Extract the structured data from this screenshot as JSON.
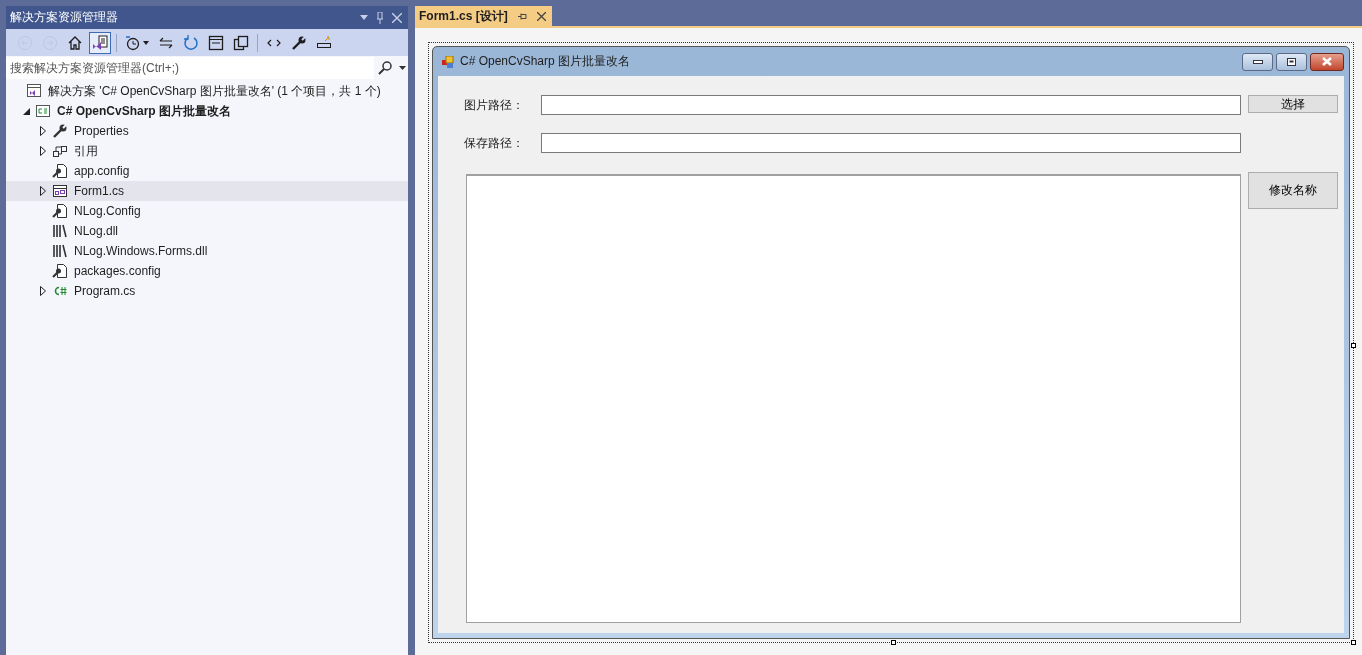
{
  "solution_explorer": {
    "title": "解决方案资源管理器",
    "toolbar": [
      {
        "kind": "back",
        "disabled": true,
        "pressed": false
      },
      {
        "kind": "forward",
        "disabled": true,
        "pressed": false
      },
      {
        "kind": "home",
        "disabled": false,
        "pressed": false
      },
      {
        "kind": "switch-views",
        "disabled": false,
        "pressed": true
      },
      {
        "kind": "pending-changes",
        "disabled": false,
        "pressed": false
      },
      {
        "kind": "sync",
        "disabled": false,
        "pressed": false
      },
      {
        "kind": "refresh",
        "disabled": false,
        "pressed": false
      },
      {
        "kind": "collapse",
        "disabled": false,
        "pressed": false
      },
      {
        "kind": "show-all",
        "disabled": false,
        "pressed": false
      },
      {
        "kind": "code",
        "disabled": false,
        "pressed": false
      },
      {
        "kind": "properties",
        "disabled": false,
        "pressed": false
      },
      {
        "kind": "preview",
        "disabled": false,
        "pressed": false
      }
    ],
    "search": {
      "placeholder": "搜索解决方案资源管理器(Ctrl+;)"
    },
    "tree": [
      {
        "kind": "solution",
        "label": "解决方案 'C# OpenCvSharp 图片批量改名' (1 个项目，共 1 个)",
        "selected": false,
        "children": [
          {
            "kind": "project",
            "label": "C# OpenCvSharp 图片批量改名",
            "expanded": true,
            "selected": false,
            "children": [
              {
                "kind": "properties",
                "label": "Properties",
                "expanded": false,
                "selected": false
              },
              {
                "kind": "references",
                "label": "引用",
                "expanded": false,
                "selected": false
              },
              {
                "kind": "config",
                "label": "app.config",
                "selected": false
              },
              {
                "kind": "form",
                "label": "Form1.cs",
                "expanded": false,
                "selected": true
              },
              {
                "kind": "config",
                "label": "NLog.Config",
                "selected": false
              },
              {
                "kind": "dll",
                "label": "NLog.dll",
                "selected": false
              },
              {
                "kind": "dll",
                "label": "NLog.Windows.Forms.dll",
                "selected": false
              },
              {
                "kind": "config",
                "label": "packages.config",
                "selected": false
              },
              {
                "kind": "csharp",
                "label": "Program.cs",
                "expanded": false,
                "selected": false
              }
            ]
          }
        ]
      }
    ]
  },
  "document_tabs": [
    {
      "label": "Form1.cs [设计]",
      "selected": true
    }
  ],
  "form": {
    "title": "C# OpenCvSharp 图片批量改名",
    "fields": [
      {
        "label": "图片路径：",
        "button": "选择"
      },
      {
        "label": "保存路径："
      }
    ],
    "action_button": "修改名称"
  }
}
